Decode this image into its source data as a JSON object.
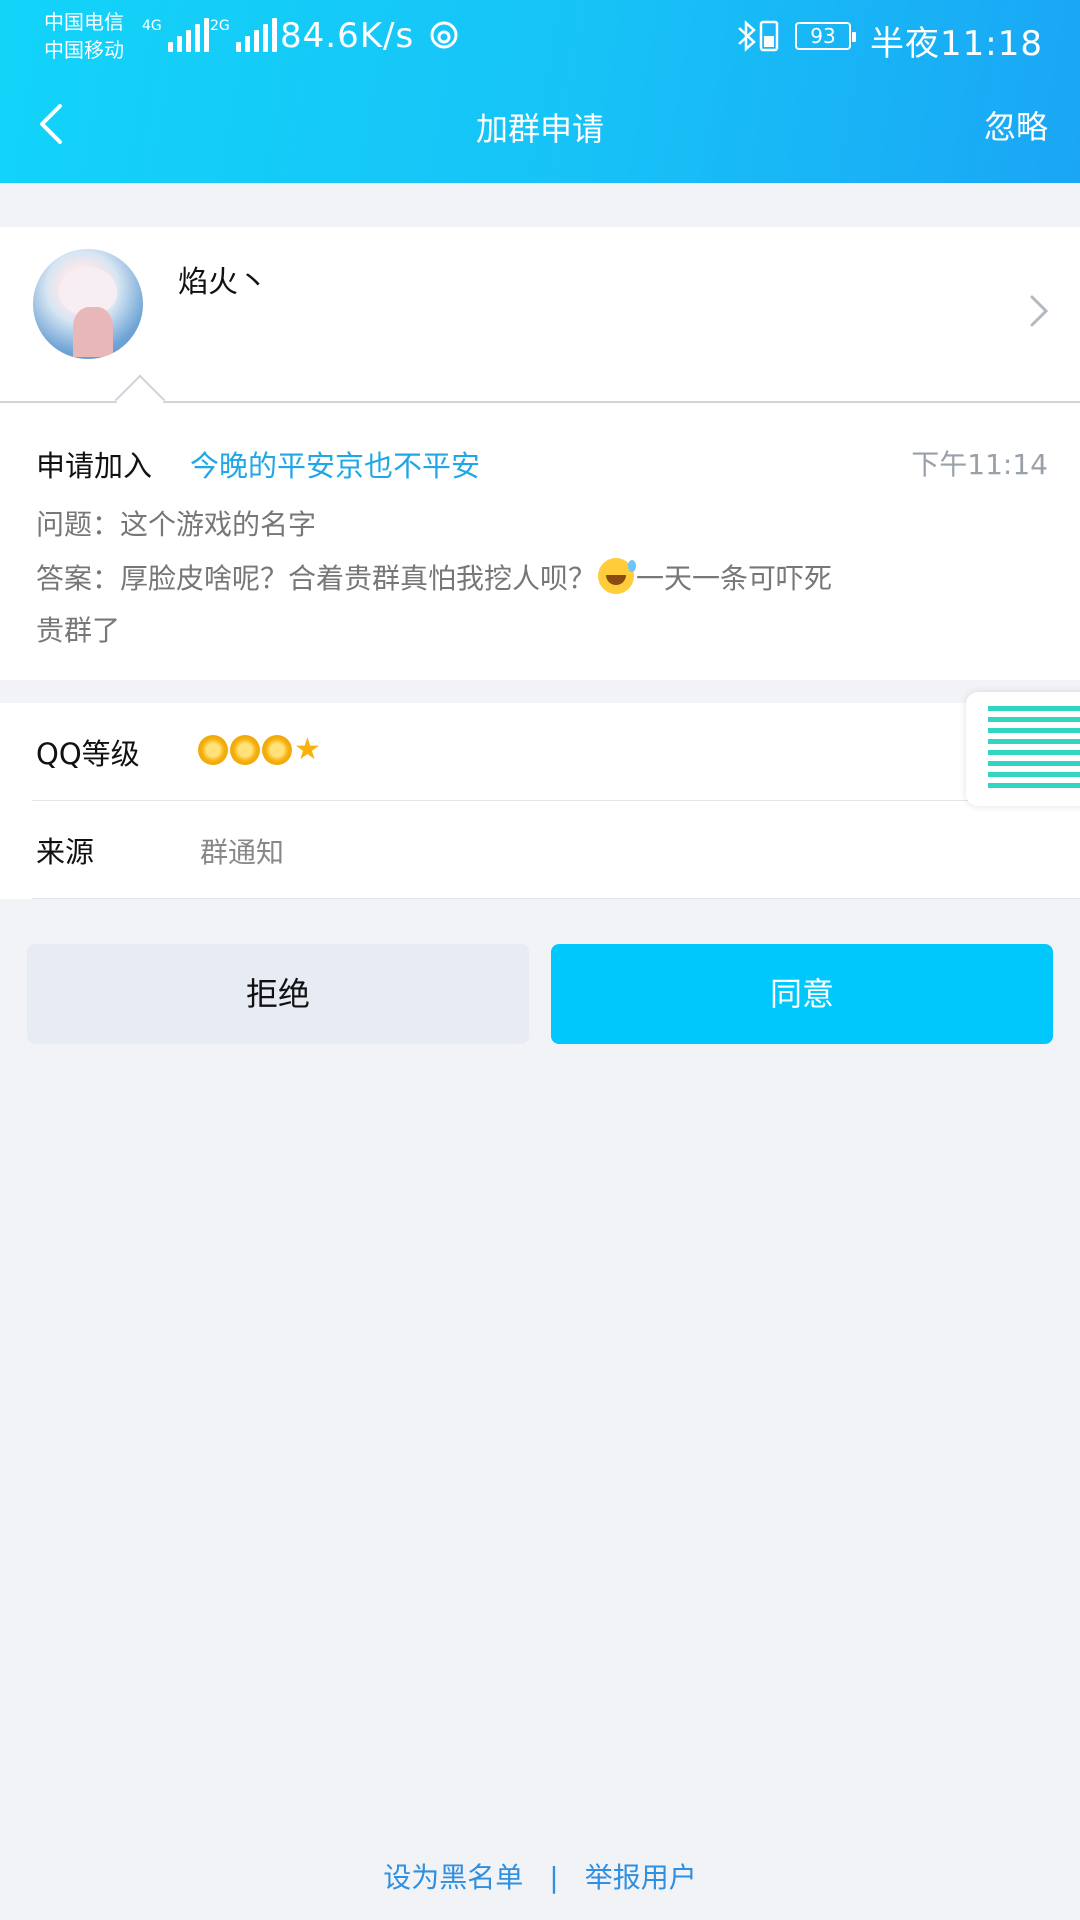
{
  "status_bar": {
    "carrier_1": "中国电信",
    "carrier_2": "中国移动",
    "net_1": "4G",
    "net_2": "2G",
    "net_speed": "84.6K/s",
    "battery": "93",
    "time": "半夜11:18"
  },
  "header": {
    "title": "加群申请",
    "ignore_label": "忽略"
  },
  "profile": {
    "nickname": "焰火丶"
  },
  "request": {
    "label": "申请加入",
    "group_name": "今晚的平安京也不平安",
    "time": "下午11:14",
    "question": "问题：这个游戏的名字",
    "answer_prefix": "答案：厚脸皮啥呢？合着贵群真怕我挖人呗？",
    "answer_suffix": "一天一条可吓死贵群了"
  },
  "info": {
    "level_label": "QQ等级",
    "level": "3 suns, 1 star",
    "source_label": "来源",
    "source_value": "群通知"
  },
  "actions": {
    "reject": "拒绝",
    "accept": "同意"
  },
  "footer": {
    "blacklist": "设为黑名单",
    "separator": "|",
    "report": "举报用户"
  },
  "colors": {
    "header_start": "#12d4f9",
    "header_end": "#1aa6f5",
    "accent": "#00c8fc",
    "link": "#21a7e6"
  }
}
